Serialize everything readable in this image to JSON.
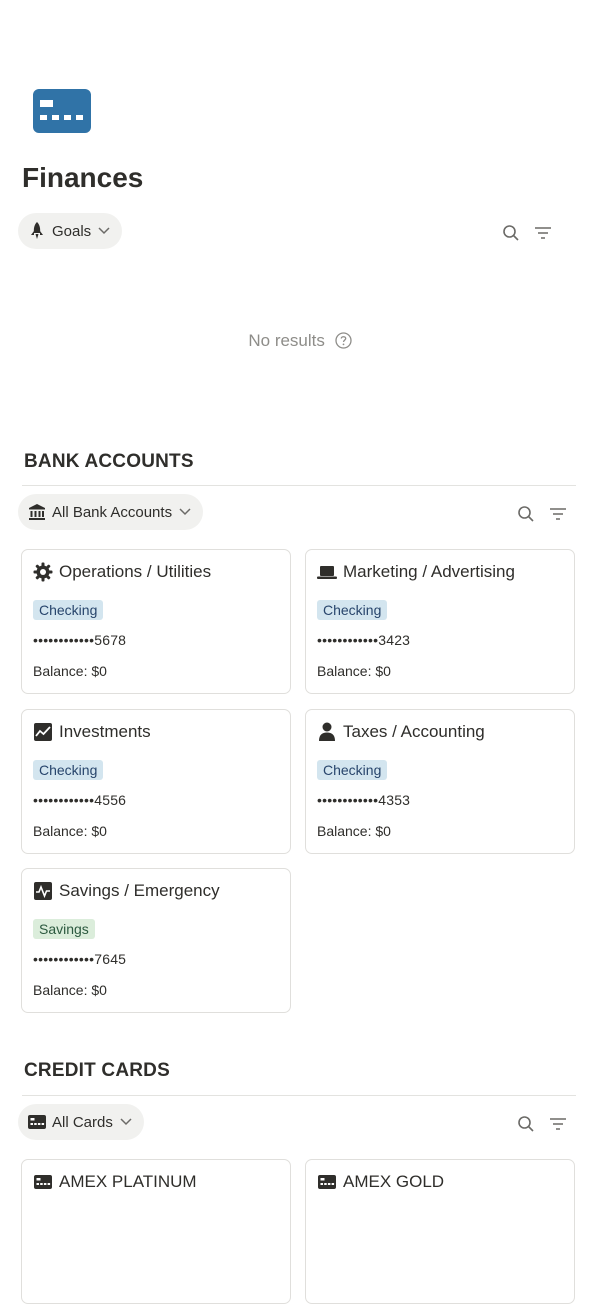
{
  "page": {
    "title": "Finances",
    "icon": "credit-card-icon",
    "accent": "#3073a7"
  },
  "goals_view": {
    "label": "Goals",
    "icon": "rocket-icon",
    "empty_text": "No results"
  },
  "bank_section": {
    "title": "BANK ACCOUNTS",
    "view_label": "All Bank Accounts",
    "view_icon": "bank-icon",
    "cards": [
      {
        "name": "Operations / Utilities",
        "icon": "gear-icon",
        "type": "Checking",
        "account": "••••••••••••5678",
        "balance": "Balance: $0"
      },
      {
        "name": "Marketing / Advertising",
        "icon": "laptop-icon",
        "type": "Checking",
        "account": "••••••••••••3423",
        "balance": "Balance: $0"
      },
      {
        "name": "Investments",
        "icon": "chart-line-icon",
        "type": "Checking",
        "account": "••••••••••••4556",
        "balance": "Balance: $0"
      },
      {
        "name": "Taxes / Accounting",
        "icon": "person-icon",
        "type": "Checking",
        "account": "••••••••••••4353",
        "balance": "Balance: $0"
      },
      {
        "name": "Savings / Emergency",
        "icon": "activity-icon",
        "type": "Savings",
        "account": "••••••••••••7645",
        "balance": "Balance: $0"
      }
    ]
  },
  "credit_section": {
    "title": "CREDIT CARDS",
    "view_label": "All Cards",
    "view_icon": "credit-card-icon",
    "cards": [
      {
        "name": "AMEX PLATINUM",
        "icon": "credit-card-icon"
      },
      {
        "name": "AMEX GOLD",
        "icon": "credit-card-icon"
      }
    ]
  },
  "colors": {
    "checking_tag_bg": "#d3e5ef",
    "savings_tag_bg": "#dbeddb",
    "pill_bg": "#f1f1ef"
  }
}
